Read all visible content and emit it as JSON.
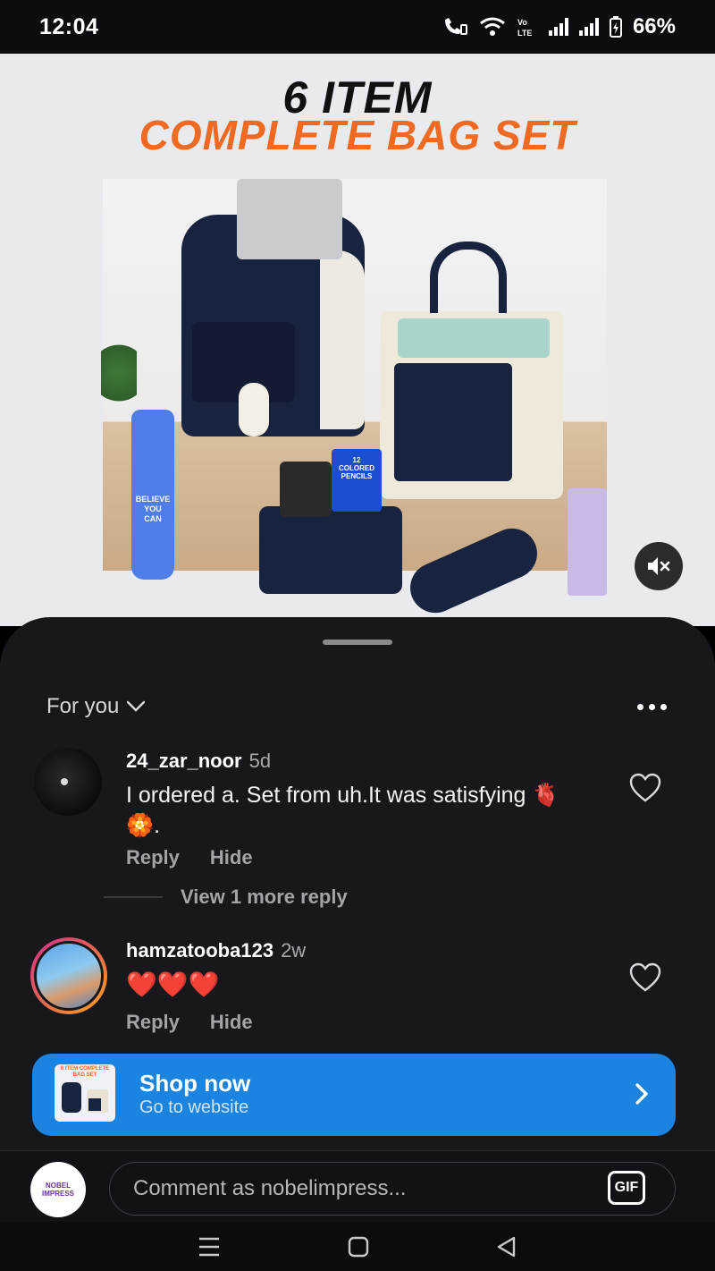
{
  "status_bar": {
    "time": "12:04",
    "battery": "66%"
  },
  "media": {
    "title_line1": "6 ITEM",
    "title_line2": "COMPLETE BAG SET",
    "bottle_text": "BELIEVE\nYOU\nCAN",
    "pencils_label": "12\nCOLORED\nPENCILS",
    "mute_icon": "speaker-muted-icon"
  },
  "feed": {
    "filter_label": "For you",
    "comments": [
      {
        "username": "24_zar_noor",
        "time": "5d",
        "text": "I ordered a. Set from uh.It was satisfying 🫀🏵️.",
        "reply": "Reply",
        "hide": "Hide"
      },
      {
        "username": "hamzatooba123",
        "time": "2w",
        "text": "❤️❤️❤️",
        "reply": "Reply",
        "hide": "Hide"
      }
    ],
    "view_more": "View 1 more reply"
  },
  "shop": {
    "title": "Shop now",
    "subtitle": "Go to website",
    "thumb_text": "6 ITEM COMPLETE BAG SET"
  },
  "composer": {
    "placeholder": "Comment as nobelimpress...",
    "gif_label": "GIF",
    "avatar_text": "NOBEL IMPRESS"
  },
  "colors": {
    "accent_orange": "#f26a21",
    "shop_blue": "#1b84e0",
    "sheet_bg": "#16181c",
    "heart_red": "#e5252a"
  }
}
